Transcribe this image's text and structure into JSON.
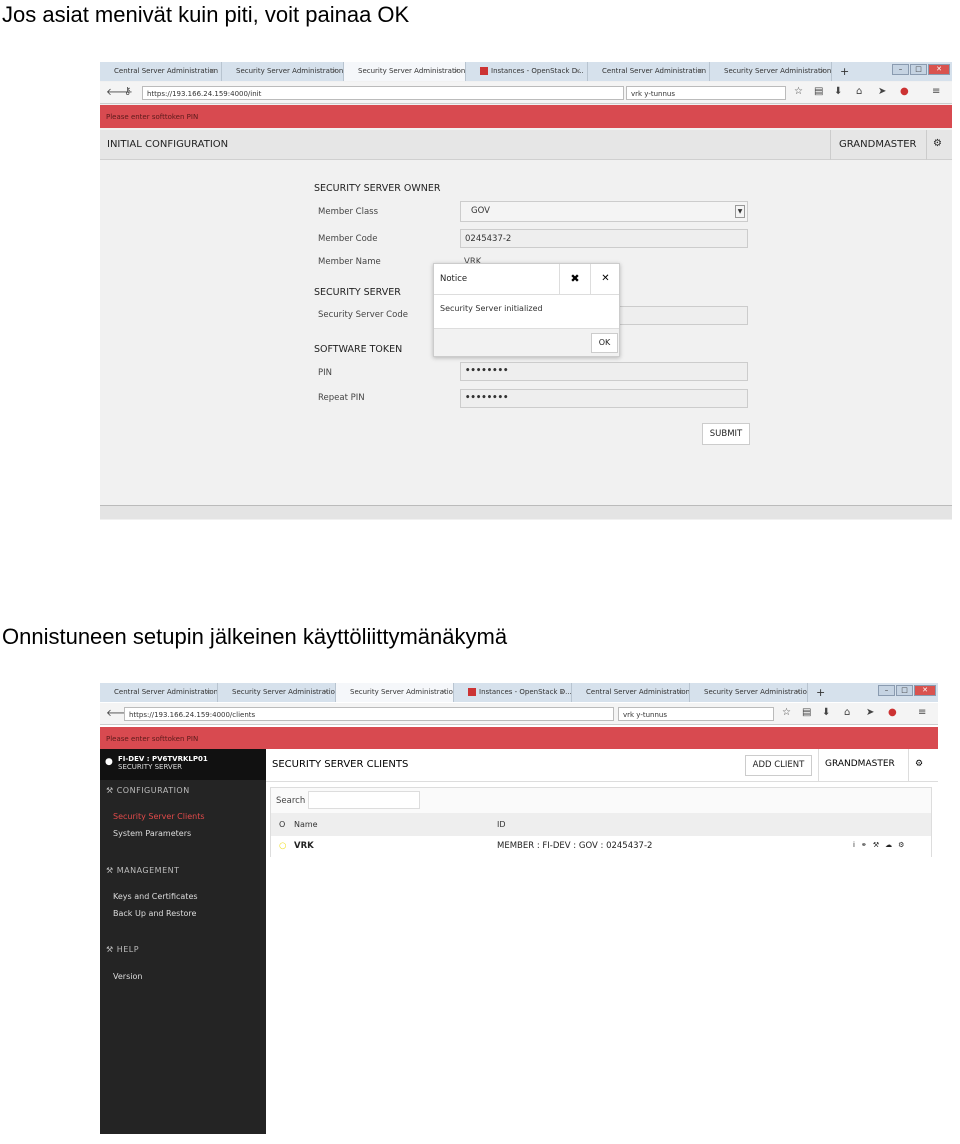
{
  "doc": {
    "heading1": "Jos asiat menivät kuin piti, voit painaa OK",
    "heading2": "Onnistuneen setupin jälkeinen käyttöliittymänäkymä"
  },
  "browser1": {
    "tabs": [
      {
        "label": "Central Server Administration"
      },
      {
        "label": "Security Server Administration"
      },
      {
        "label": "Security Server Administration",
        "active": true
      },
      {
        "label": "Instances - OpenStack D..."
      },
      {
        "label": "Central Server Administration"
      },
      {
        "label": "Security Server Administration"
      }
    ],
    "url": "https://193.166.24.159:4000/init",
    "search": "vrk y-tunnus"
  },
  "page1": {
    "alert": "Please enter softtoken PIN",
    "title": "INITIAL CONFIGURATION",
    "user": "GRANDMASTER",
    "owner_heading": "SECURITY SERVER OWNER",
    "member_class_label": "Member Class",
    "member_class": "GOV",
    "member_code_label": "Member Code",
    "member_code": "0245437-2",
    "member_name_label": "Member Name",
    "member_name": "VRK",
    "server_heading": "SECURITY SERVER",
    "server_code_label": "Security Server Code",
    "token_heading": "SOFTWARE TOKEN",
    "pin_label": "PIN",
    "pin": "••••••••",
    "repeat_pin_label": "Repeat PIN",
    "repeat_pin": "••••••••",
    "submit": "SUBMIT"
  },
  "dialog": {
    "title": "Notice",
    "message": "Security Server initialized",
    "ok": "OK"
  },
  "browser2": {
    "tabs": [
      {
        "label": "Central Server Administration"
      },
      {
        "label": "Security Server Administration"
      },
      {
        "label": "Security Server Administration",
        "active": true
      },
      {
        "label": "Instances - OpenStack D..."
      },
      {
        "label": "Central Server Administration"
      },
      {
        "label": "Security Server Administration"
      }
    ],
    "url": "https://193.166.24.159:4000/clients",
    "search": "vrk y-tunnus"
  },
  "page2": {
    "alert": "Please enter softtoken PIN",
    "server_name": "FI-DEV : PV6TVRKLP01",
    "server_type": "SECURITY SERVER",
    "sidebar": [
      {
        "heading": "CONFIGURATION",
        "items": [
          "Security Server Clients",
          "System Parameters"
        ]
      },
      {
        "heading": "MANAGEMENT",
        "items": [
          "Keys and Certificates",
          "Back Up and Restore"
        ]
      },
      {
        "heading": "HELP",
        "items": [
          "Version"
        ]
      }
    ],
    "active_item": "Security Server Clients",
    "accent": "#d84a50",
    "title": "SECURITY SERVER CLIENTS",
    "add_client": "ADD CLIENT",
    "user": "GRANDMASTER",
    "search_label": "Search",
    "col_name": "Name",
    "col_id": "ID",
    "rows": [
      {
        "name": "VRK",
        "id": "MEMBER : FI-DEV : GOV : 0245437-2",
        "status_color": "#f0e030"
      }
    ]
  }
}
